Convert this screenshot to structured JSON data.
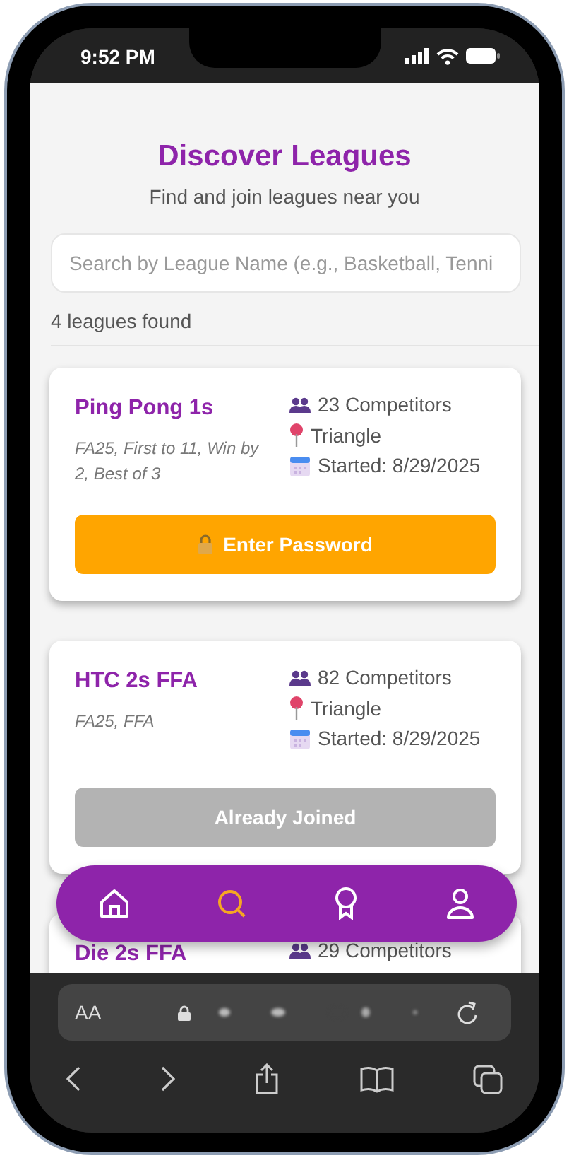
{
  "status_bar": {
    "time": "9:52 PM"
  },
  "header": {
    "title": "Discover Leagues",
    "subtitle": "Find and join leagues near you"
  },
  "search": {
    "placeholder": "Search by League Name (e.g., Basketball, Tenni"
  },
  "result_count": "4 leagues found",
  "leagues": [
    {
      "name": "Ping Pong 1s",
      "description": "FA25, First to 11, Win by 2, Best of 3",
      "competitors": "23 Competitors",
      "location": "Triangle",
      "started": "Started: 8/29/2025",
      "action": {
        "kind": "password",
        "label": "Enter Password"
      }
    },
    {
      "name": "HTC 2s FFA",
      "description": "FA25, FFA",
      "competitors": "82 Competitors",
      "location": "Triangle",
      "started": "Started: 8/29/2025",
      "action": {
        "kind": "joined",
        "label": "Already Joined"
      }
    },
    {
      "name": "Die 2s FFA",
      "competitors": "29 Competitors"
    }
  ],
  "nav": [
    {
      "kind": "home",
      "selected": false
    },
    {
      "kind": "search",
      "selected": true
    },
    {
      "kind": "award",
      "selected": false
    },
    {
      "kind": "profile",
      "selected": false
    }
  ],
  "browser": {
    "text_size": "AA"
  }
}
